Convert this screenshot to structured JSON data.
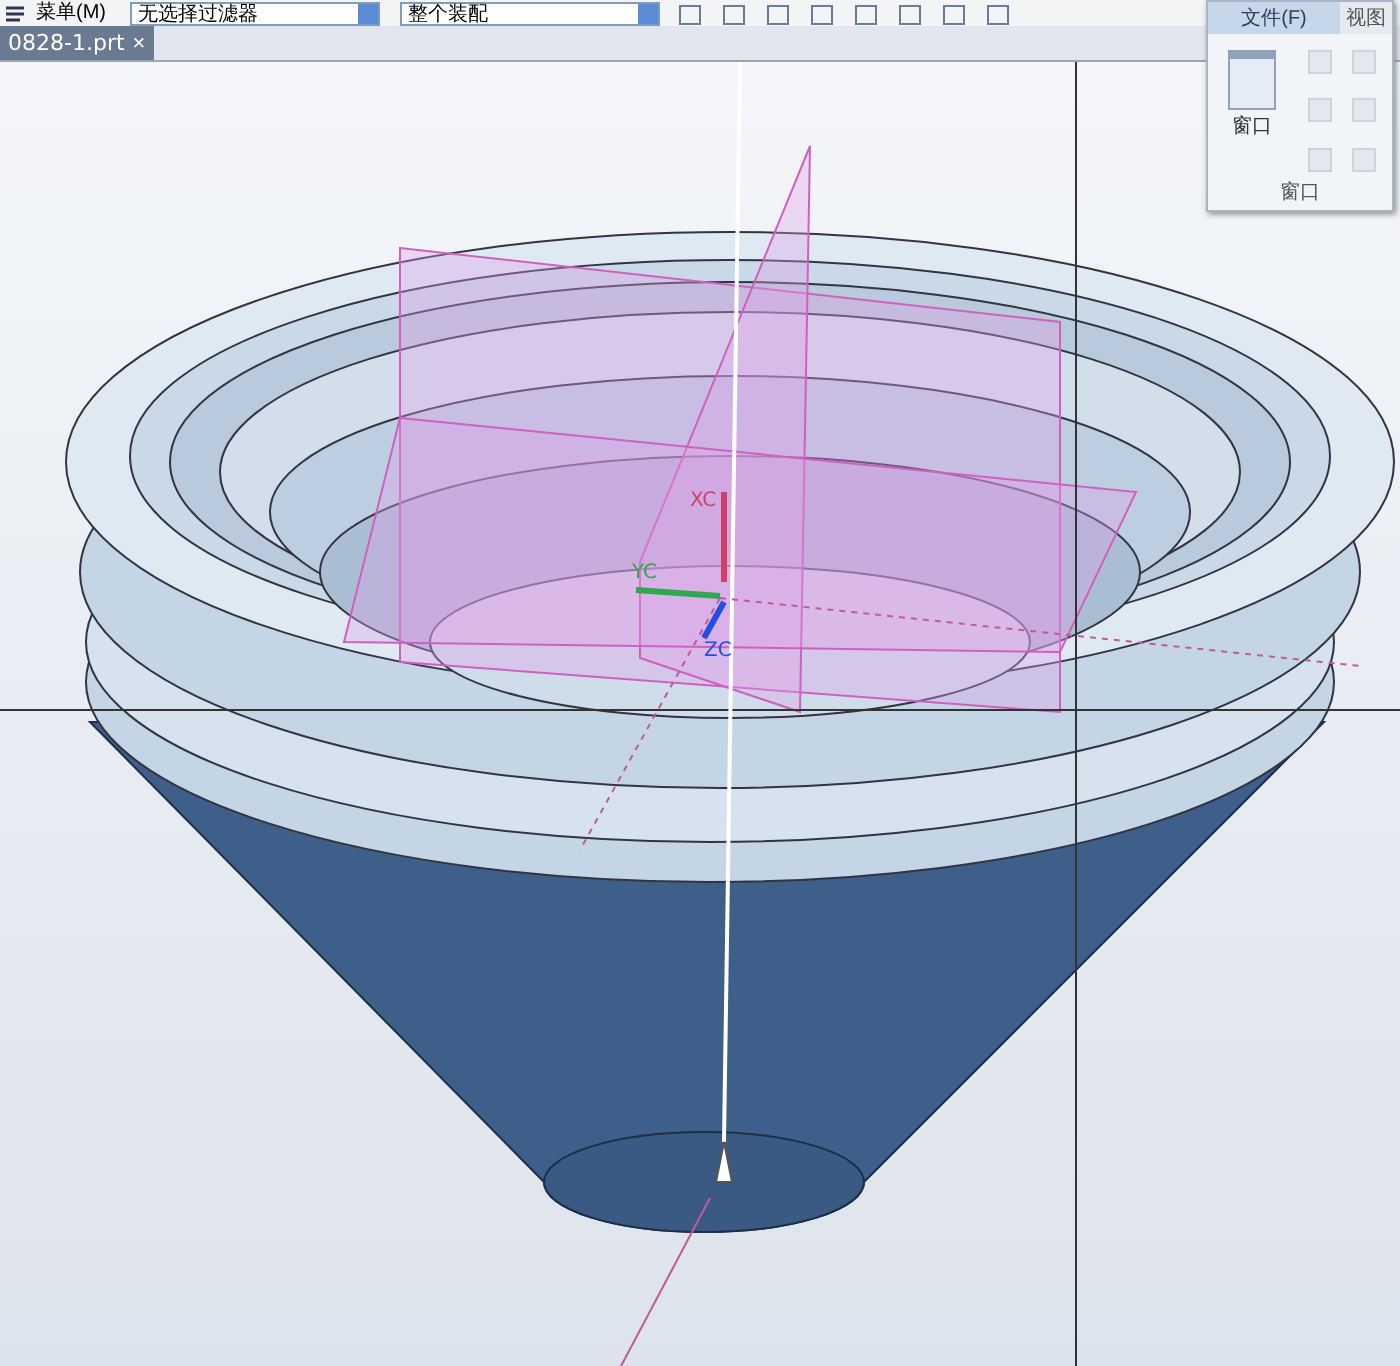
{
  "toolbar": {
    "menu_button": "菜单(M)",
    "dropdowns": [
      {
        "value": "无选择过滤器"
      },
      {
        "value": "整个装配"
      }
    ]
  },
  "document_tabs": [
    {
      "label": "0828-1.prt",
      "close": "×",
      "selected": true
    }
  ],
  "ribbon_tabs": [
    {
      "label": "文件(F)",
      "selected": true
    },
    {
      "label": "视图",
      "selected": false
    }
  ],
  "window_menu": {
    "button_label": "窗口",
    "group_label": "窗口"
  },
  "axes": [
    {
      "label": "XC",
      "color": "#d0406a"
    },
    {
      "label": "YC",
      "color": "#2fa84f"
    },
    {
      "label": "ZC",
      "color": "#2050e0"
    }
  ]
}
